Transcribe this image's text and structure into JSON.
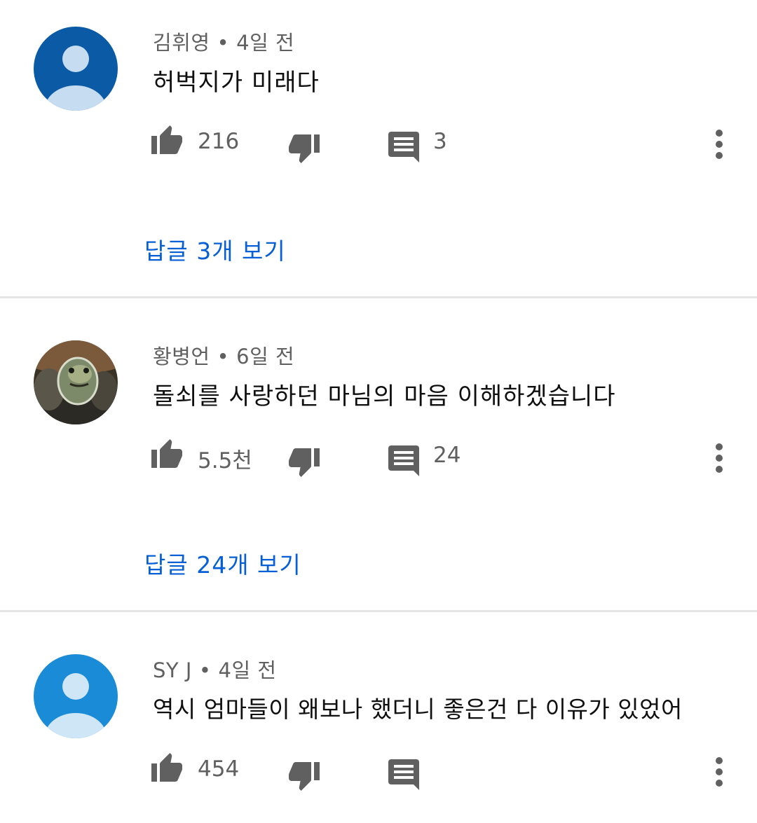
{
  "colors": {
    "link": "#065fd4",
    "icon": "#606060",
    "avatar_dark_blue": "#0b5aa6",
    "avatar_light_blue": "#1a8bd6"
  },
  "comments": [
    {
      "author": "김휘영",
      "separator": "•",
      "time": "4일 전",
      "text": "허벅지가 미래다",
      "likes": "216",
      "replies_count": "3",
      "view_replies_label": "답글 3개 보기",
      "avatar": "default-avatar-dark-blue"
    },
    {
      "author": "황병언",
      "separator": "•",
      "time": "6일 전",
      "text": "돌쇠를 사랑하던 마님의 마음 이해하겠습니다",
      "likes": "5.5천",
      "replies_count": "24",
      "view_replies_label": "답글 24개 보기",
      "avatar": "turtle-photo-avatar"
    },
    {
      "author": "SY J",
      "separator": "•",
      "time": "4일 전",
      "text": "역시 엄마들이 왜보나 했더니 좋은건 다 이유가 있었어",
      "likes": "454",
      "replies_count": "",
      "avatar": "default-avatar-light-blue"
    }
  ],
  "icons": {
    "like": "thumbs-up-icon",
    "dislike": "thumbs-down-icon",
    "reply": "comment-icon",
    "more": "more-vert-icon"
  }
}
